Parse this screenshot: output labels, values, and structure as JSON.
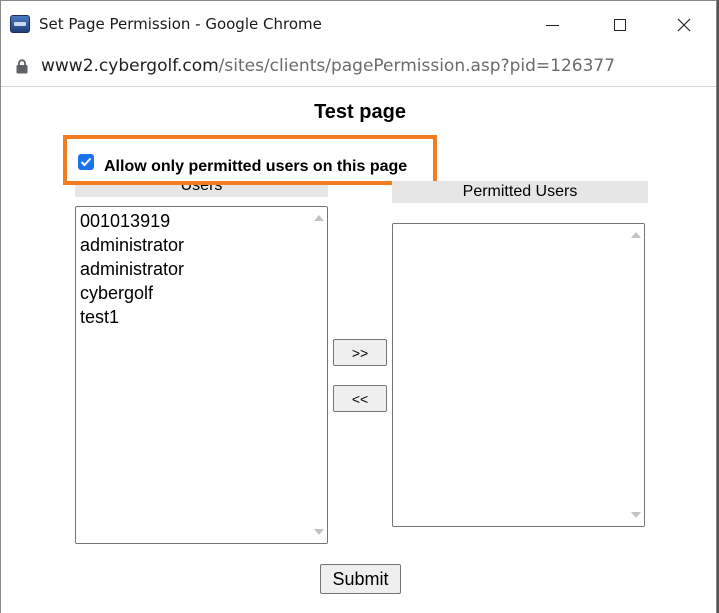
{
  "window": {
    "title": "Set Page Permission - Google Chrome",
    "icon": "app-icon",
    "controls": [
      "minimize-icon",
      "maximize-icon",
      "close-icon"
    ]
  },
  "address_bar": {
    "host": "www2.cybergolf.com",
    "path": "/sites/clients/pagePermission.asp?pid=126377",
    "icon": "lock-icon"
  },
  "page": {
    "title": "Test page",
    "permission_checkbox": {
      "label": "Allow only permitted users on this page",
      "checked": true
    },
    "users": {
      "header": "Users",
      "items": [
        "001013919",
        "administrator",
        "administrator",
        "cybergolf",
        "test1"
      ]
    },
    "permitted_users": {
      "header": "Permitted Users",
      "items": []
    },
    "add_button": ">>",
    "remove_button": "<<",
    "submit_button": "Submit"
  },
  "colors": {
    "highlight": "#f47d20",
    "checkbox": "#1a73e8"
  }
}
